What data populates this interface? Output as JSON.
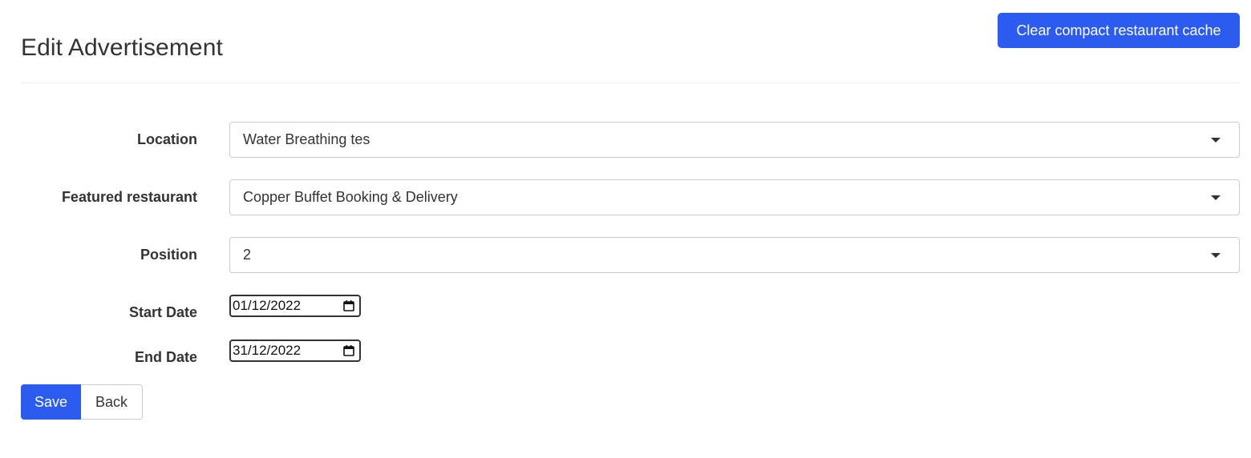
{
  "header": {
    "title": "Edit Advertisement",
    "clear_cache_label": "Clear compact restaurant cache"
  },
  "form": {
    "location": {
      "label": "Location",
      "selected": "Water Breathing tes"
    },
    "featured_restaurant": {
      "label": "Featured restaurant",
      "selected": "Copper Buffet Booking & Delivery"
    },
    "position": {
      "label": "Position",
      "selected": "2"
    },
    "start_date": {
      "label": "Start Date",
      "value": "01/12/2022"
    },
    "end_date": {
      "label": "End Date",
      "value": "31/12/2022"
    }
  },
  "actions": {
    "save_label": "Save",
    "back_label": "Back"
  },
  "icons": {
    "dropdown": "caret-down-icon",
    "date_picker": "calendar-icon"
  },
  "colors": {
    "primary": "#2c5bf0",
    "text": "#333333",
    "border": "#cccccc"
  }
}
